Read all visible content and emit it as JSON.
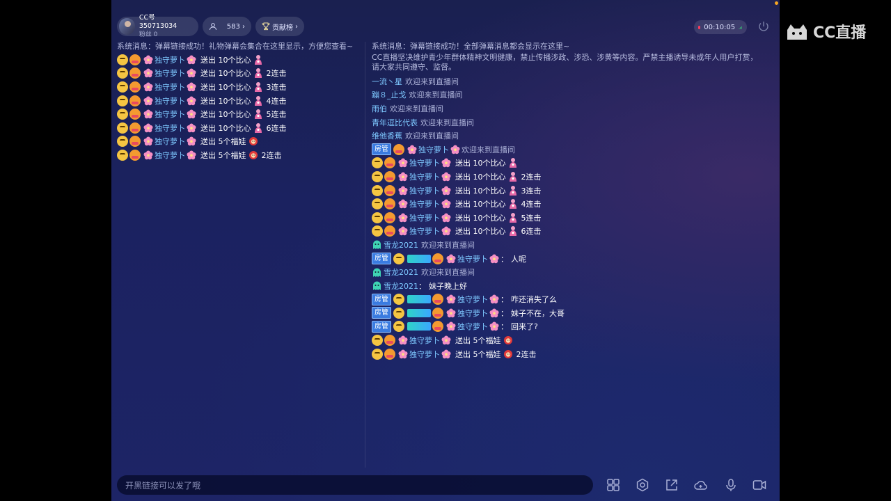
{
  "header": {
    "user_id": "CC号 350713034",
    "fans": "粉丝 0",
    "viewers": "583",
    "rank_label": "贡献榜",
    "timer": "00:10:05",
    "logo_text": "CC直播"
  },
  "left_panel": {
    "system_message": "系统消息：弹幕链接成功！礼物弹幕会集合在这里显示，方便您查看~",
    "rows": [
      {
        "name": "独守萝卜",
        "action": "送出 10个比心",
        "combo": ""
      },
      {
        "name": "独守萝卜",
        "action": "送出 10个比心",
        "combo": "2连击"
      },
      {
        "name": "独守萝卜",
        "action": "送出 10个比心",
        "combo": "3连击"
      },
      {
        "name": "独守萝卜",
        "action": "送出 10个比心",
        "combo": "4连击"
      },
      {
        "name": "独守萝卜",
        "action": "送出 10个比心",
        "combo": "5连击"
      },
      {
        "name": "独守萝卜",
        "action": "送出 10个比心",
        "combo": "6连击"
      },
      {
        "name": "独守萝卜",
        "action": "送出 5个福娃",
        "combo": ""
      },
      {
        "name": "独守萝卜",
        "action": "送出 5个福娃",
        "combo": "2连击"
      }
    ]
  },
  "right_panel": {
    "system_message": "系统消息：弹幕链接成功！全部弹幕消息都会显示在这里~",
    "notice": "CC直播坚决维护青少年群体精神文明健康，禁止传播涉政、涉恐、涉黄等内容。严禁主播诱导未成年人用户打赏，请大家共同遵守、监督。",
    "welcomes": [
      {
        "name": "一流丶星",
        "text": "欢迎来到直播间"
      },
      {
        "name": "蹦８_止戈",
        "text": "欢迎来到直播间"
      },
      {
        "name": "雨伯",
        "text": "欢迎来到直播间"
      },
      {
        "name": "青年逗比代表",
        "text": "欢迎来到直播间"
      },
      {
        "name": "维他香蕉",
        "text": "欢迎来到直播间"
      }
    ],
    "admin_badge": "房管",
    "admin_welcome": {
      "name": "独守萝卜",
      "text": "欢迎来到直播间"
    },
    "gifts": [
      {
        "name": "独守萝卜",
        "action": "送出 10个比心",
        "combo": ""
      },
      {
        "name": "独守萝卜",
        "action": "送出 10个比心",
        "combo": "2连击"
      },
      {
        "name": "独守萝卜",
        "action": "送出 10个比心",
        "combo": "3连击"
      },
      {
        "name": "独守萝卜",
        "action": "送出 10个比心",
        "combo": "4连击"
      },
      {
        "name": "独守萝卜",
        "action": "送出 10个比心",
        "combo": "5连击"
      },
      {
        "name": "独守萝卜",
        "action": "送出 10个比心",
        "combo": "6连击"
      }
    ],
    "xuelong_welcome": {
      "name": "雪龙2021",
      "text": "欢迎来到直播间"
    },
    "chat1": {
      "name": "独守萝卜",
      "colon": "：",
      "text": "人呢"
    },
    "xuelong_welcome2": {
      "name": "雪龙2021",
      "text": "欢迎来到直播间"
    },
    "xuelong_chat": {
      "name": "雪龙2021",
      "colon": "：",
      "text": "妹子晚上好"
    },
    "chat2": {
      "name": "独守萝卜",
      "colon": "：",
      "text": "咋还消失了么"
    },
    "chat3": {
      "name": "独守萝卜",
      "colon": "：",
      "text": "妹子不在，大哥"
    },
    "chat4": {
      "name": "独守萝卜",
      "colon": "：",
      "text": "回来了?"
    },
    "gifts2": [
      {
        "name": "独守萝卜",
        "action": "送出 5个福娃",
        "combo": ""
      },
      {
        "name": "独守萝卜",
        "action": "送出 5个福娃",
        "combo": "2连击"
      }
    ]
  },
  "input": {
    "placeholder": "开黑链接可以发了哦"
  },
  "toolbar_icons": [
    "grid-icon",
    "settings-icon",
    "share-icon",
    "cloud-game-icon",
    "microphone-icon",
    "camera-icon"
  ],
  "colors": {
    "username": "#7ec8ff",
    "admin_badge": "#3a7be0",
    "record": "#ff3b5c"
  }
}
